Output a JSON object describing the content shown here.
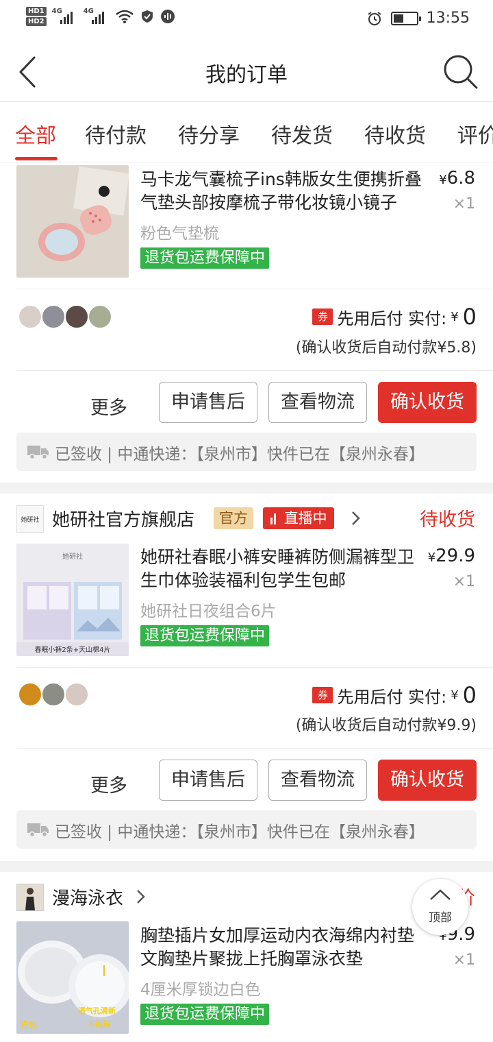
{
  "status_bar": {
    "hd_labels": [
      "HD1",
      "HD2"
    ],
    "network_1": "4G",
    "network_2": "4G",
    "time": "13:55"
  },
  "nav": {
    "title": "我的订单",
    "back_icon": "chevron-left-icon",
    "search_icon": "search-icon"
  },
  "tabs": [
    {
      "label": "全部",
      "active": true
    },
    {
      "label": "待付款"
    },
    {
      "label": "待分享"
    },
    {
      "label": "待发货"
    },
    {
      "label": "待收货"
    },
    {
      "label": "评价"
    }
  ],
  "orders": [
    {
      "product": {
        "title": "马卡龙气囊梳子ins韩版女生便携折叠气垫头部按摩梳子带化妆镜小镜子",
        "price": "6.8",
        "currency": "¥",
        "qty": "×1",
        "sku": "粉色气垫梳",
        "guarantee": "退货包运费保障中"
      },
      "payment": {
        "coupon": "券",
        "label": "先用后付 实付:",
        "currency": "¥",
        "amount": "0",
        "auto_pay": "(确认收货后自动付款¥5.8)"
      },
      "actions": {
        "more": "更多",
        "after_sale": "申请售后",
        "logistics": "查看物流",
        "confirm": "确认收货"
      },
      "logistics_text": "已签收 | 中通快递：【泉州市】快件已在【泉州永春】"
    },
    {
      "shop": {
        "logo_text": "她研社",
        "name": "她研社官方旗舰店",
        "official": "官方",
        "live": "直播中",
        "status": "待收货"
      },
      "product": {
        "title": "她研社春眠小裤安睡裤防侧漏裤型卫生巾体验装福利包学生包邮",
        "price": "29.9",
        "currency": "¥",
        "qty": "×1",
        "sku": "她研社日夜组合6片",
        "guarantee": "退货包运费保障中",
        "image_caption": "春眠小裤2条+天山棉4片"
      },
      "payment": {
        "coupon": "券",
        "label": "先用后付 实付:",
        "currency": "¥",
        "amount": "0",
        "auto_pay": "(确认收货后自动付款¥9.9)"
      },
      "actions": {
        "more": "更多",
        "after_sale": "申请售后",
        "logistics": "查看物流",
        "confirm": "确认收货"
      },
      "logistics_text": "已签收 | 中通快递：【泉州市】快件已在【泉州永春】"
    },
    {
      "shop": {
        "name": "漫海泳衣",
        "status": "评价"
      },
      "product": {
        "title": "胸垫插片女加厚运动内衣海绵内衬垫文胸垫片聚拢上托胸罩泳衣垫",
        "price": "9.9",
        "currency": "¥",
        "qty": "×1",
        "sku": "4厘米厚锁边白色",
        "guarantee": "退货包运费保障中",
        "image_tag_color": "白色",
        "image_tag_feature_1": "透气孔清新",
        "image_tag_feature_2": "不闷热"
      }
    }
  ],
  "back_to_top": {
    "label": "顶部",
    "icon": "arrow-up-icon"
  },
  "colors": {
    "accent": "#e0322b",
    "guarantee_green": "#34b34a",
    "official_gold": "#f3d6a5"
  }
}
